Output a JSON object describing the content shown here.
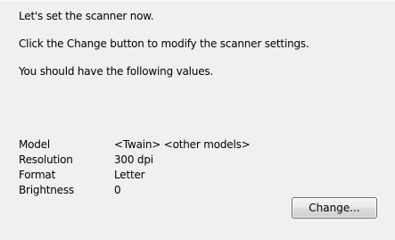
{
  "instructions": {
    "line1": "Let's set the scanner now.",
    "line2": "Click the Change button to modify the scanner settings.",
    "line3": "You should have the following values."
  },
  "settings": [
    {
      "label": "Model",
      "value": "<Twain> <other models>"
    },
    {
      "label": "Resolution",
      "value": "300 dpi"
    },
    {
      "label": "Format",
      "value": "Letter"
    },
    {
      "label": "Brightness",
      "value": "0"
    }
  ],
  "change_button_label": "Change..."
}
